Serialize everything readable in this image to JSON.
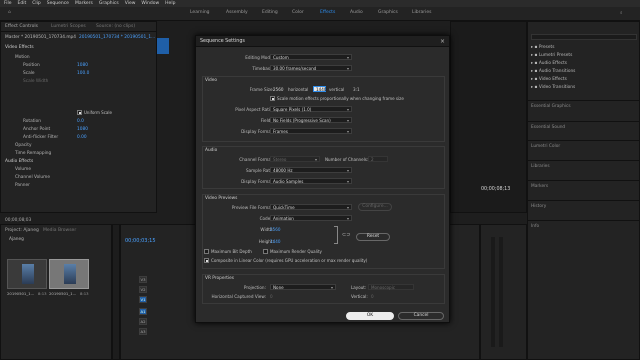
{
  "menubar": [
    "File",
    "Edit",
    "Clip",
    "Sequence",
    "Markers",
    "Graphics",
    "View",
    "Window",
    "Help"
  ],
  "workspaces": [
    {
      "label": "Learning",
      "active": false
    },
    {
      "label": "Assembly",
      "active": false
    },
    {
      "label": "Editing",
      "active": false
    },
    {
      "label": "Color",
      "active": false
    },
    {
      "label": "Effects",
      "active": true
    },
    {
      "label": "Audio",
      "active": false
    },
    {
      "label": "Graphics",
      "active": false
    },
    {
      "label": "Libraries",
      "active": false
    }
  ],
  "source_tabs": [
    "Effect Controls",
    "Lumetri Scopes",
    "Source: (no clips)",
    "Audio Clip Mixer: 20190501_170734"
  ],
  "effect_controls": {
    "master": "Master * 20190501_170734.mp4",
    "clip": "20190501_170734 * 20190501_1...",
    "section": "Video Effects",
    "rows": [
      "Motion",
      "Position",
      "Scale",
      "Scale Width",
      "Rotation",
      "Anchor Point",
      "Anti-flicker Filter",
      "Opacity",
      "Time Remapping",
      "Audio Effects",
      "Volume",
      "Channel Volume",
      "Panner"
    ],
    "values": {
      "position": "1080",
      "scale": "100.0",
      "rotation": "0.0",
      "anchor": "1080",
      "anti_flicker": "0.00",
      "uniform_scale": "Uniform Scale"
    },
    "timecode": "00;00;08;03"
  },
  "dialog": {
    "title": "Sequence Settings",
    "editing_mode_label": "Editing Mode:",
    "editing_mode": "Custom",
    "timebase_label": "Timebase:",
    "timebase": "30.00 frames/second",
    "video_section": "Video",
    "frame_size_label": "Frame Size:",
    "frame_w": "2560",
    "horizontal_label": "horizontal",
    "frame_h": "1440",
    "vertical_label": "vertical",
    "aspect": "3:1",
    "scale_effects_text": "Scale motion effects proportionally when changing frame size",
    "pixel_aspect_label": "Pixel Aspect Ratio:",
    "pixel_aspect": "Square Pixels (1.0)",
    "fields_label": "Fields:",
    "fields": "No Fields (Progressive Scan)",
    "display_format_label": "Display Format:",
    "display_format": "Frames",
    "audio_section": "Audio",
    "channel_format_label": "Channel Format:",
    "channel_format": "Stereo",
    "num_channels_label": "Number of Channels:",
    "num_channels": "2",
    "sample_rate_label": "Sample Rate:",
    "sample_rate": "48000 Hz",
    "audio_display_label": "Display Format:",
    "audio_display": "Audio Samples",
    "previews_section": "Video Previews",
    "preview_format_label": "Preview File Format:",
    "preview_format": "QuickTime",
    "configure_label": "Configure...",
    "codec_label": "Codec:",
    "codec": "Animation",
    "width_label": "Width:",
    "width_val": "2560",
    "height_label": "Height:",
    "height_val": "1440",
    "reset_label": "Reset",
    "max_bit_depth": "Maximum Bit Depth",
    "max_render_quality": "Maximum Render Quality",
    "linear_color": "Composite in Linear Color (requires GPU acceleration or max render quality)",
    "vr_section": "VR Properties",
    "projection_label": "Projection:",
    "projection": "None",
    "layout_label": "Layout:",
    "layout": "Monoscopic",
    "h_view_label": "Horizontal Captured View:",
    "h_view": "0",
    "vertical_label2": "Vertical:",
    "v_view": "0",
    "ok_label": "OK",
    "cancel_label": "Cancel"
  },
  "project": {
    "tabs": [
      "Project: Ajaneg",
      "Media Browser"
    ],
    "name": "Ajaneg",
    "clips": [
      {
        "name": "20190501_1...",
        "dur": "8:13"
      },
      {
        "name": "20190501_1...",
        "dur": "8:13"
      }
    ]
  },
  "timeline": {
    "timecode": "00;00;03;15",
    "tracks": [
      "V3",
      "V2",
      "V1",
      "A1",
      "A2",
      "A3"
    ]
  },
  "program": {
    "timecode": "00;00;08;13"
  },
  "right_panel": {
    "items": [
      "Presets",
      "Lumetri Presets",
      "Audio Effects",
      "Audio Transitions",
      "Video Effects",
      "Video Transitions"
    ],
    "sections": [
      "Essential Graphics",
      "Essential Sound",
      "Lumetri Color",
      "Libraries",
      "Markers",
      "History",
      "Info"
    ]
  },
  "colors": {
    "accent": "#2d8ceb",
    "bg": "#1e1e1e",
    "panel": "#232323",
    "dialog": "#2b2b2b"
  }
}
